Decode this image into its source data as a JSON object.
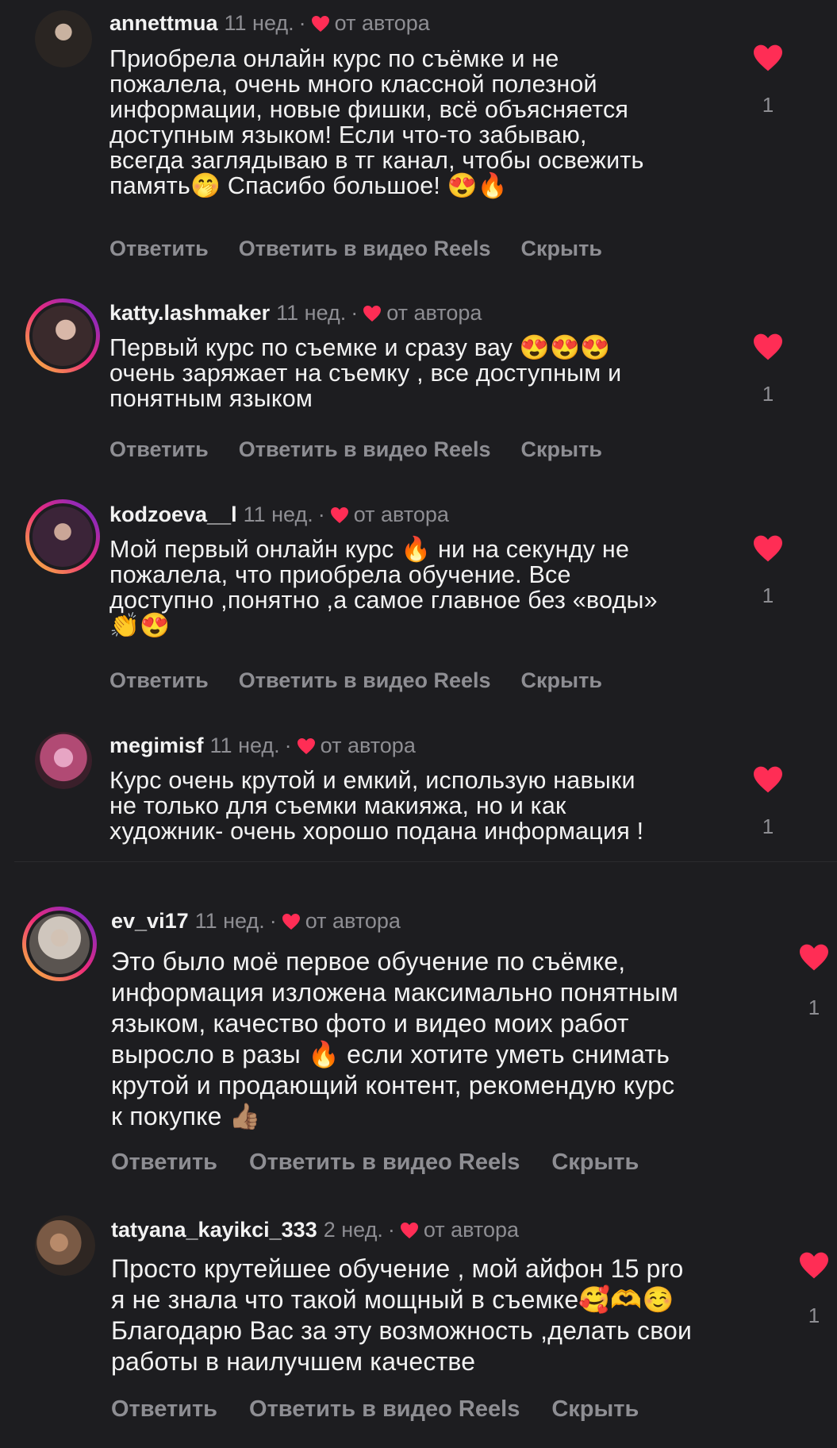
{
  "actions": {
    "reply": "Ответить",
    "reply_reels": "Ответить в видео Reels",
    "hide": "Скрыть"
  },
  "author_label": "от автора",
  "comments": [
    {
      "username": "annettmua",
      "time": "11 нед.",
      "text": "Приобрела онлайн курс по съёмке и не\nпожалела, очень много классной полезной\nинформации, новые фишки, всё объясняется\nдоступным языком! Если что-то забываю,\nвсегда заглядываю в тг канал, чтобы освежить\nпамять🤭 Спасибо большое! 😍🔥",
      "likes": "1"
    },
    {
      "username": "katty.lashmaker",
      "time": "11 нед.",
      "text": "Первый курс по съемке и сразу вау 😍😍😍\nочень заряжает на съемку , все доступным и\nпонятным языком",
      "likes": "1"
    },
    {
      "username": "kodzoeva__l",
      "time": "11 нед.",
      "text": "Мой первый онлайн курс 🔥 ни на секунду не\nпожалела, что приобрела обучение. Все\nдоступно ,понятно ,а самое главное без «воды»\n👏😍",
      "likes": "1"
    },
    {
      "username": "megimisf",
      "time": "11 нед.",
      "text": "Курс очень крутой и емкий, использую навыки\nне только для съемки макияжа, но и как\nхудожник- очень хорошо подана информация !",
      "likes": "1"
    },
    {
      "username": "ev_vi17",
      "time": "11 нед.",
      "text": "Это было моё первое обучение по съёмке,\nинформация изложена максимально понятным\nязыком, качество фото и видео моих работ\nвыросло в разы 🔥 если хотите уметь снимать\nкрутой и продающий контент, рекомендую курс\nк покупке 👍🏽",
      "likes": "1"
    },
    {
      "username": "tatyana_kayikci_333",
      "time": "2 нед.",
      "text": "Просто крутейшее обучение , мой айфон 15 pro\nя не знала что такой мощный в съемке🥰🫶☺️\nБлагодарю Вас за эту возможность ,делать свои\nработы в наилучшем качестве",
      "likes": "1"
    }
  ],
  "colors": {
    "background": "#1d1d20",
    "text": "#f2f2f2",
    "muted": "#8e8e93",
    "heart": "#ff2d55"
  }
}
